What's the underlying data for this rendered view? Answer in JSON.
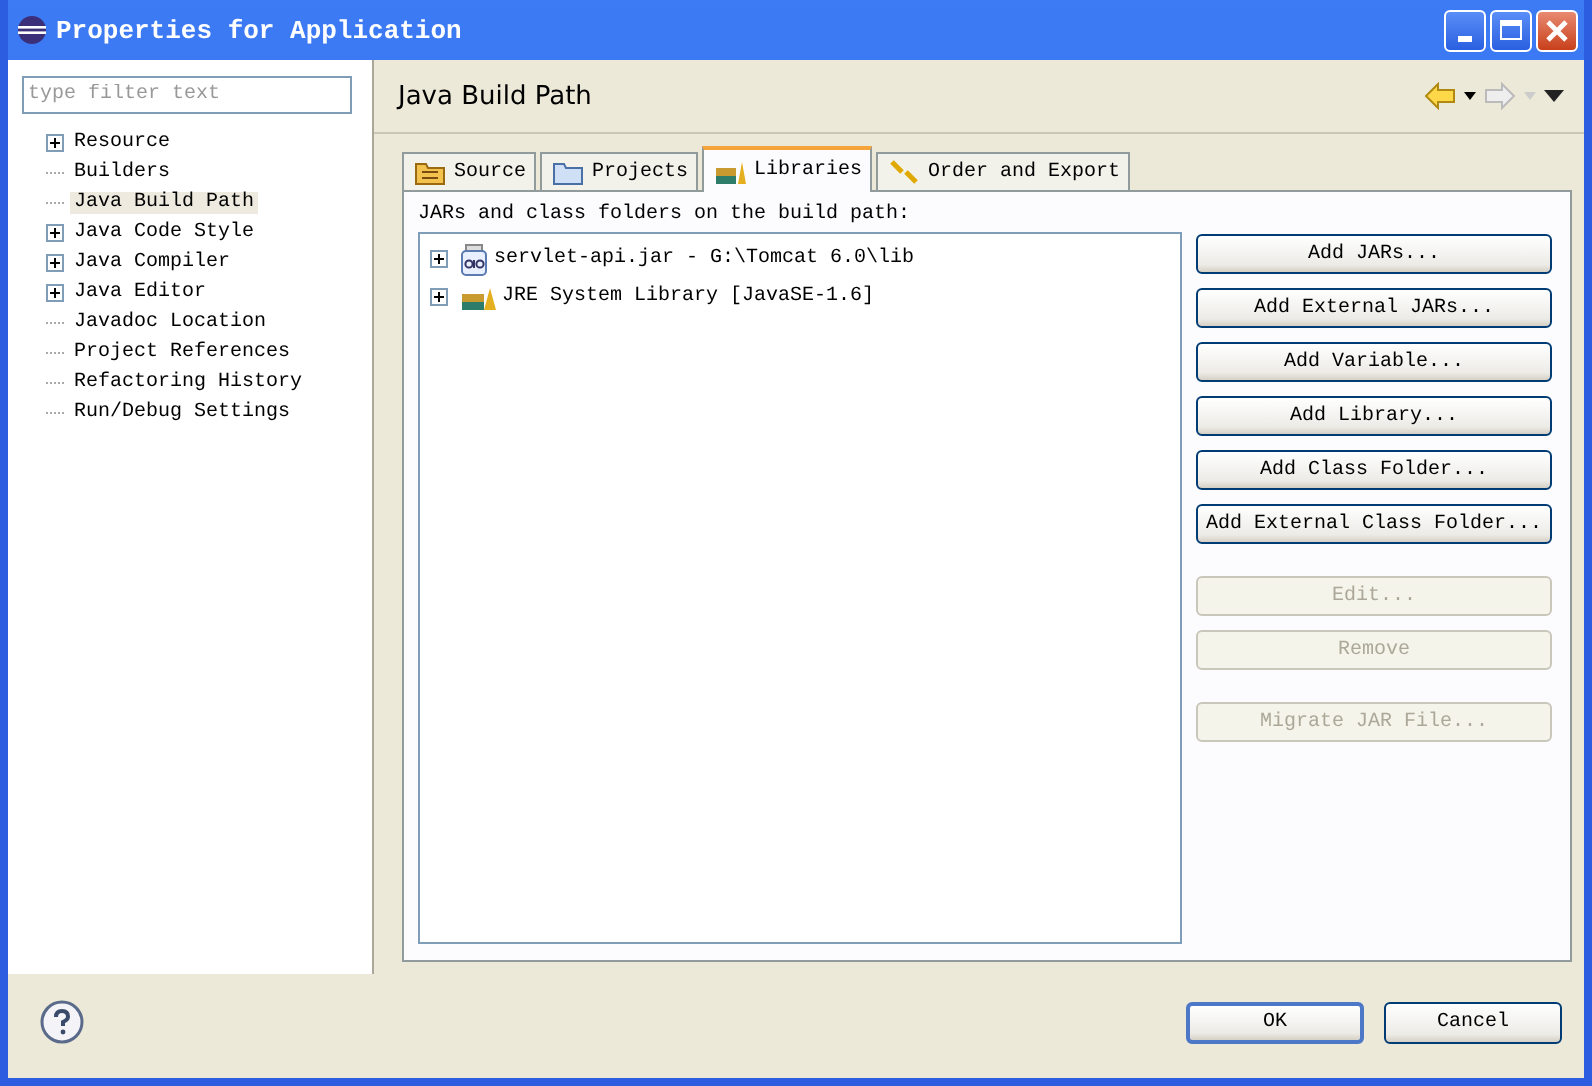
{
  "window": {
    "title": "Properties for Application"
  },
  "filter": {
    "placeholder": "type filter text"
  },
  "sidebar": {
    "items": [
      {
        "label": "Resource",
        "has_children": true,
        "selected": false
      },
      {
        "label": "Builders",
        "has_children": false,
        "selected": false
      },
      {
        "label": "Java Build Path",
        "has_children": false,
        "selected": true
      },
      {
        "label": "Java Code Style",
        "has_children": true,
        "selected": false
      },
      {
        "label": "Java Compiler",
        "has_children": true,
        "selected": false
      },
      {
        "label": "Java Editor",
        "has_children": true,
        "selected": false
      },
      {
        "label": "Javadoc Location",
        "has_children": false,
        "selected": false
      },
      {
        "label": "Project References",
        "has_children": false,
        "selected": false
      },
      {
        "label": "Refactoring History",
        "has_children": false,
        "selected": false
      },
      {
        "label": "Run/Debug Settings",
        "has_children": false,
        "selected": false
      }
    ]
  },
  "page": {
    "title": "Java Build Path"
  },
  "tabs": [
    {
      "label": "Source",
      "selected": false
    },
    {
      "label": "Projects",
      "selected": false
    },
    {
      "label": "Libraries",
      "selected": true
    },
    {
      "label": "Order and Export",
      "selected": false
    }
  ],
  "libraries": {
    "label": "JARs and class folders on the build path:",
    "entries": [
      {
        "kind": "jar",
        "label": "servlet-api.jar - G:\\Tomcat 6.0\\lib"
      },
      {
        "kind": "jre",
        "label": "JRE System Library [JavaSE-1.6]"
      }
    ]
  },
  "action_groups": [
    {
      "buttons": [
        {
          "label": "Add JARs...",
          "disabled": false
        },
        {
          "label": "Add External JARs...",
          "disabled": false
        },
        {
          "label": "Add Variable...",
          "disabled": false
        },
        {
          "label": "Add Library...",
          "disabled": false
        },
        {
          "label": "Add Class Folder...",
          "disabled": false
        },
        {
          "label": "Add External Class Folder...",
          "disabled": false
        }
      ]
    },
    {
      "buttons": [
        {
          "label": "Edit...",
          "disabled": true
        },
        {
          "label": "Remove",
          "disabled": true
        }
      ]
    },
    {
      "buttons": [
        {
          "label": "Migrate JAR File...",
          "disabled": true
        }
      ]
    }
  ],
  "buttons": [
    {
      "label": "OK",
      "default": true
    },
    {
      "label": "Cancel",
      "default": false
    }
  ]
}
